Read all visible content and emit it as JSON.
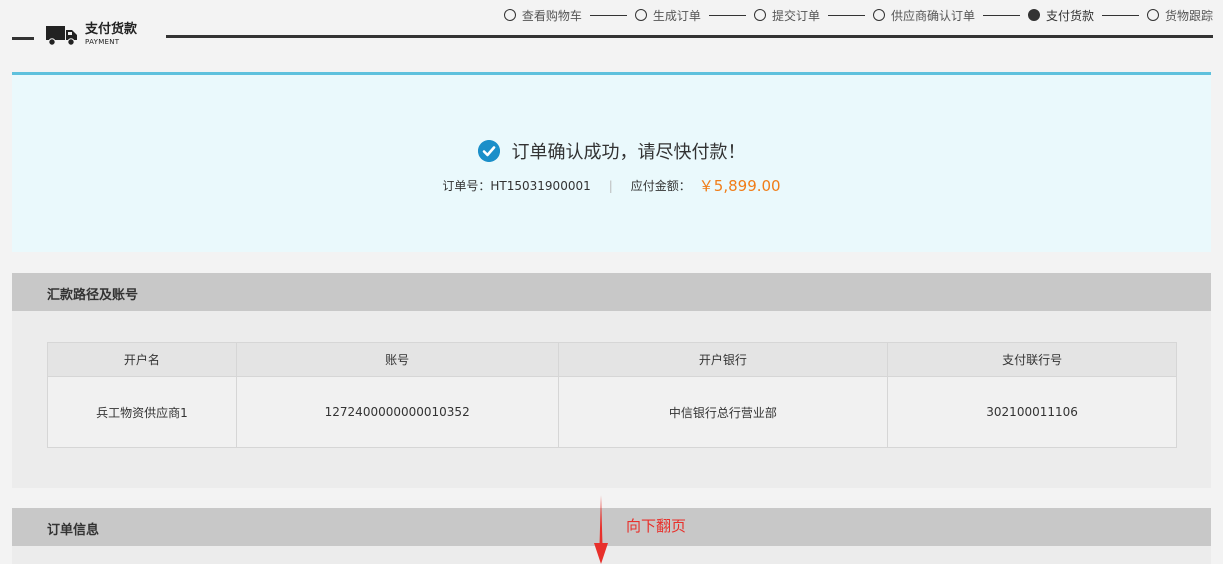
{
  "brand": {
    "title": "支付货款",
    "subtitle": "PAYMENT"
  },
  "steps": [
    {
      "label": "查看购物车",
      "active": false
    },
    {
      "label": "生成订单",
      "active": false
    },
    {
      "label": "提交订单",
      "active": false
    },
    {
      "label": "供应商确认订单",
      "active": false
    },
    {
      "label": "支付货款",
      "active": true
    },
    {
      "label": "货物跟踪",
      "active": false
    }
  ],
  "success": {
    "message": "订单确认成功，请尽快付款！",
    "order_label": "订单号：",
    "order_no": "HT15031900001",
    "separator": "|",
    "amount_label": "应付金额：",
    "amount": "￥5,899.00"
  },
  "remittance": {
    "title": "汇款路径及账号",
    "headers": [
      "开户名",
      "账号",
      "开户银行",
      "支付联行号"
    ],
    "rows": [
      [
        "兵工物资供应商1",
        "1272400000000010352",
        "中信银行总行营业部",
        "302100011106"
      ]
    ]
  },
  "order_info": {
    "title": "订单信息"
  },
  "annotation": {
    "text": "向下翻页"
  },
  "colors": {
    "accent": "#5ec1dd",
    "check": "#1b8fc9",
    "amount": "#f07d18",
    "annotation": "#e8302b"
  }
}
